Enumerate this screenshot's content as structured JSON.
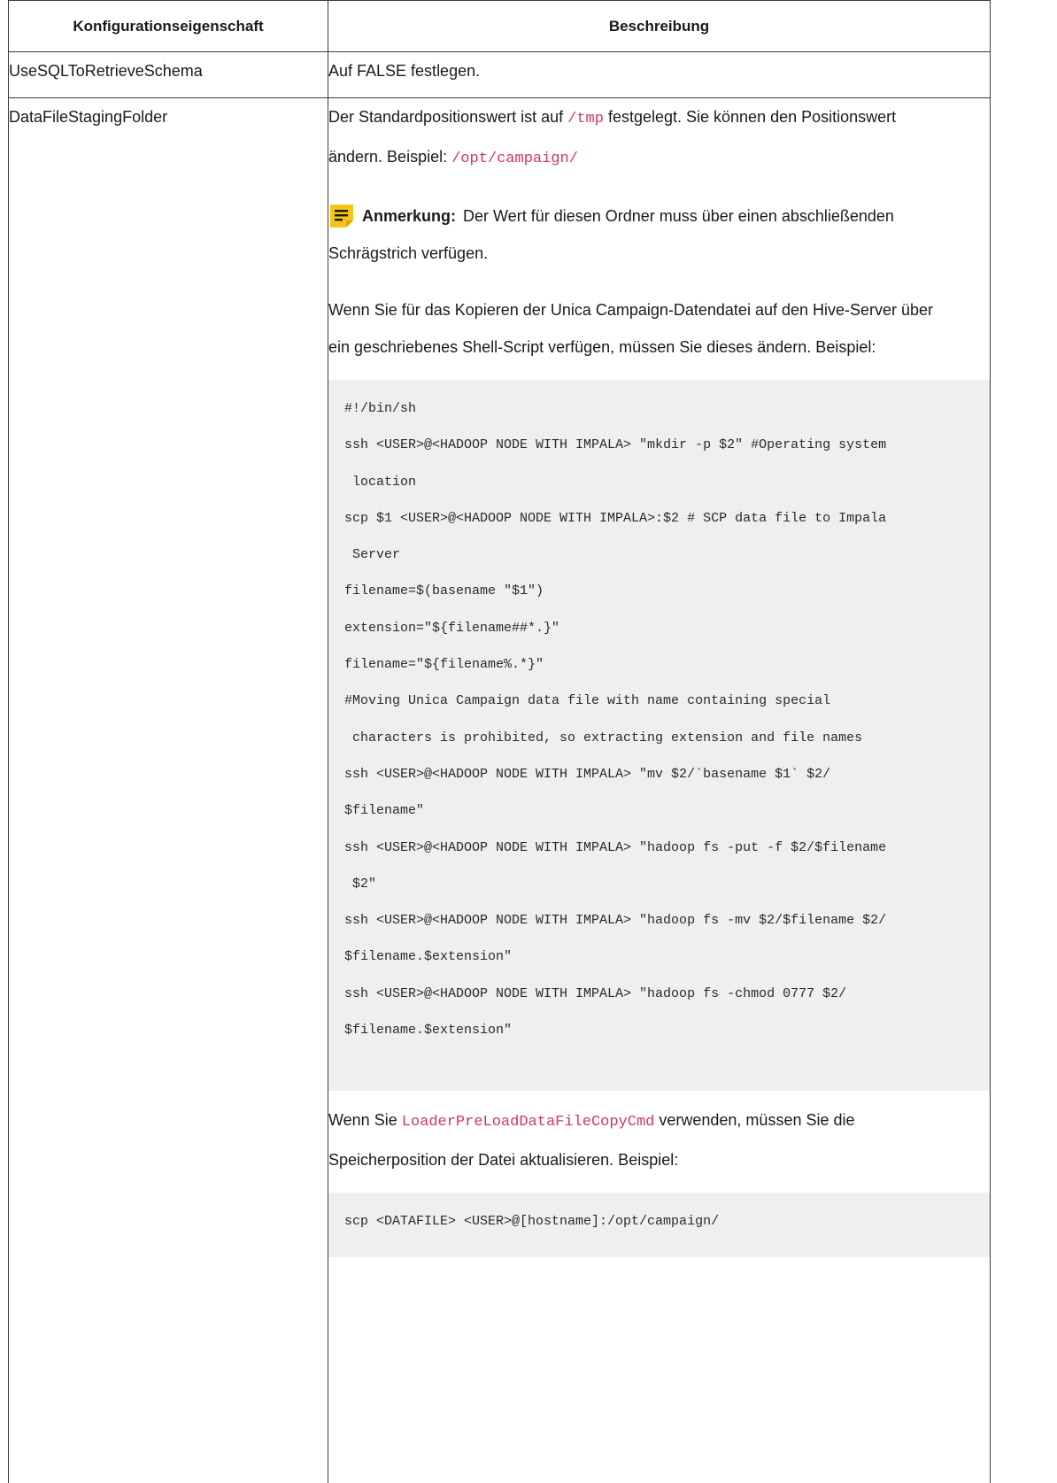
{
  "table": {
    "header_property": "Konfigurationseigenschaft",
    "header_description": "Beschreibung",
    "rows": [
      {
        "property": "UseSQLToRetrieveSchema",
        "description": "Auf FALSE festlegen."
      },
      {
        "property": "DataFileStagingFolder"
      }
    ]
  },
  "staging": {
    "p1_line1_a": "Der Standardpositionswert ist auf ",
    "p1_code_tmp": "/tmp",
    "p1_line1_b": " festgelegt. Sie können den Positionswert",
    "p1_line2_a": "ändern. Beispiel: ",
    "p1_code_opt": "/opt/campaign/",
    "note_label": "Anmerkung:",
    "note_line1": "Der Wert für diesen Ordner muss über einen abschließenden",
    "note_line2": "Schrägstrich verfügen.",
    "p2_line1": "Wenn Sie für das Kopieren der Unica Campaign-Datendatei auf den Hive-Server über",
    "p2_line2": "ein geschriebenes Shell-Script verfügen, müssen Sie dieses ändern. Beispiel:",
    "code_lines": [
      "#!/bin/sh",
      "ssh <USER>@<HADOOP NODE WITH IMPALA> \"mkdir -p $2\" #Operating system",
      " location",
      "scp $1 <USER>@<HADOOP NODE WITH IMPALA>:$2 # SCP data file to Impala",
      " Server",
      "filename=$(basename \"$1\")",
      "extension=\"${filename##*.}\"",
      "filename=\"${filename%.*}\"",
      "#Moving Unica Campaign data file with name containing special",
      " characters is prohibited, so extracting extension and file names",
      "ssh <USER>@<HADOOP NODE WITH IMPALA> \"mv $2/`basename $1` $2/",
      "$filename\"",
      "ssh <USER>@<HADOOP NODE WITH IMPALA> \"hadoop fs -put -f $2/$filename",
      " $2\"",
      "ssh <USER>@<HADOOP NODE WITH IMPALA> \"hadoop fs -mv $2/$filename $2/",
      "$filename.$extension\"",
      "ssh <USER>@<HADOOP NODE WITH IMPALA> \"hadoop fs -chmod 0777 $2/",
      "$filename.$extension\""
    ],
    "p3_line1_a": "Wenn Sie ",
    "p3_code": "LoaderPreLoadDataFileCopyCmd",
    "p3_line1_b": " verwenden, müssen Sie die",
    "p3_line2": "Speicherposition der Datei aktualisieren. Beispiel:",
    "code2_lines": [
      "scp <DATAFILE> <USER>@[hostname]:/opt/campaign/"
    ]
  },
  "colors": {
    "code_inline": "#d6336c",
    "code_bg": "#efefef",
    "note_icon": "#f5c518",
    "border": "#3a3a3a"
  },
  "icons": {
    "note": "note-icon"
  }
}
